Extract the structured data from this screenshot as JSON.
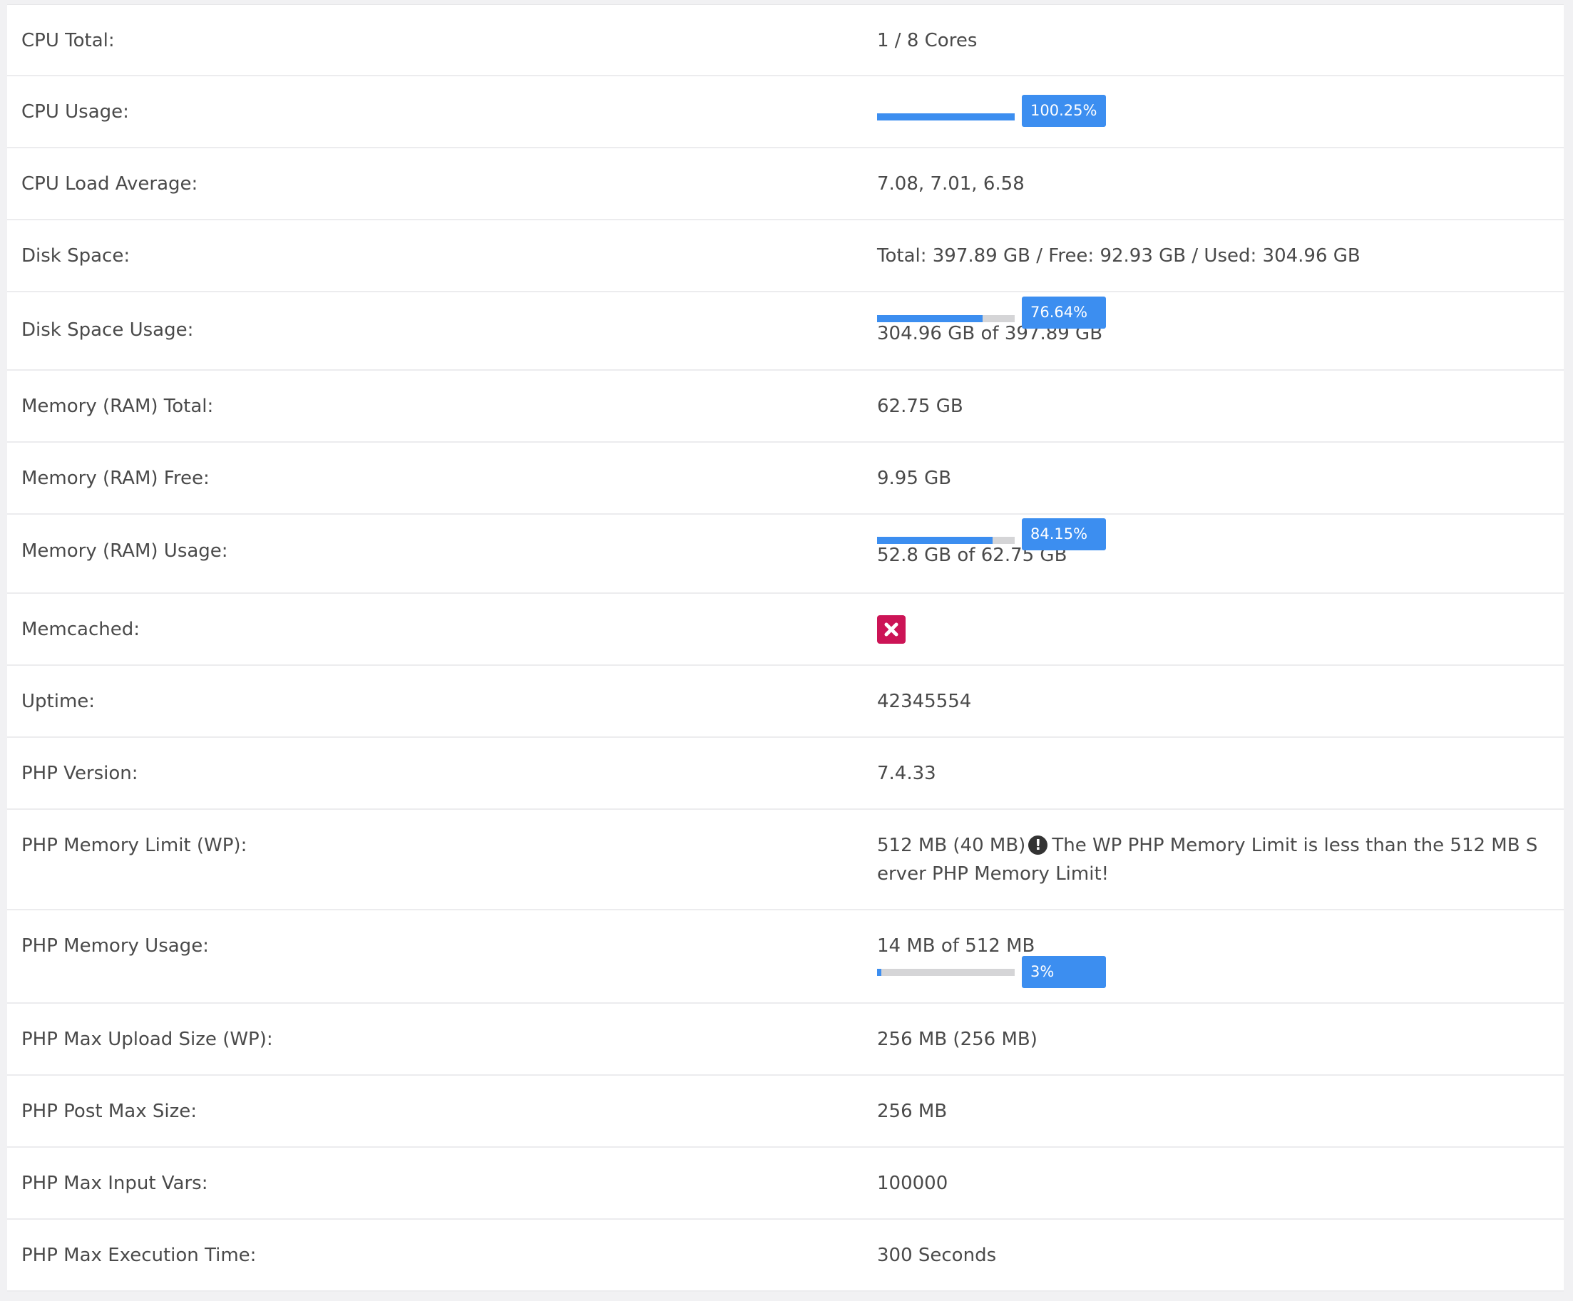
{
  "rows": {
    "cpu_total": {
      "label": "CPU Total:",
      "value": "1 / 8 Cores"
    },
    "cpu_usage": {
      "label": "CPU Usage:",
      "percent_text": "100.25%",
      "percent": 100
    },
    "cpu_load": {
      "label": "CPU Load Average:",
      "value": "7.08, 7.01, 6.58"
    },
    "disk_space": {
      "label": "Disk Space:",
      "value": "Total: 397.89 GB / Free: 92.93 GB / Used: 304.96 GB"
    },
    "disk_usage": {
      "label": "Disk Space Usage:",
      "percent_text": "76.64%",
      "percent": 76.64,
      "detail": "304.96 GB of 397.89 GB"
    },
    "mem_total": {
      "label": "Memory (RAM) Total:",
      "value": "62.75 GB"
    },
    "mem_free": {
      "label": "Memory (RAM) Free:",
      "value": "9.95 GB"
    },
    "mem_usage": {
      "label": "Memory (RAM) Usage:",
      "percent_text": "84.15%",
      "percent": 84.15,
      "detail": "52.8 GB of 62.75 GB"
    },
    "memcached": {
      "label": "Memcached:",
      "status_icon": "x-icon",
      "status_color": "#cc1456"
    },
    "uptime": {
      "label": "Uptime:",
      "value": "42345554"
    },
    "php_version": {
      "label": "PHP Version:",
      "value": "7.4.33"
    },
    "php_mem_limit": {
      "label": "PHP Memory Limit (WP):",
      "value": "512 MB (40 MB)",
      "warning_icon": "exclamation-circle-icon",
      "warning": "The WP PHP Memory Limit is less than the 512 MB Server PHP Memory Limit!"
    },
    "php_mem_usage": {
      "label": "PHP Memory Usage:",
      "detail": "14 MB of 512 MB",
      "percent_text": "3%",
      "percent": 3
    },
    "php_max_upload": {
      "label": "PHP Max Upload Size (WP):",
      "value": "256 MB (256 MB)"
    },
    "php_post_max": {
      "label": "PHP Post Max Size:",
      "value": "256 MB"
    },
    "php_max_input": {
      "label": "PHP Max Input Vars:",
      "value": "100000"
    },
    "php_max_exec": {
      "label": "PHP Max Execution Time:",
      "value": "300 Seconds"
    }
  },
  "colors": {
    "accent": "#3c8ef0",
    "track": "#d5d5d7",
    "danger": "#cc1456"
  }
}
